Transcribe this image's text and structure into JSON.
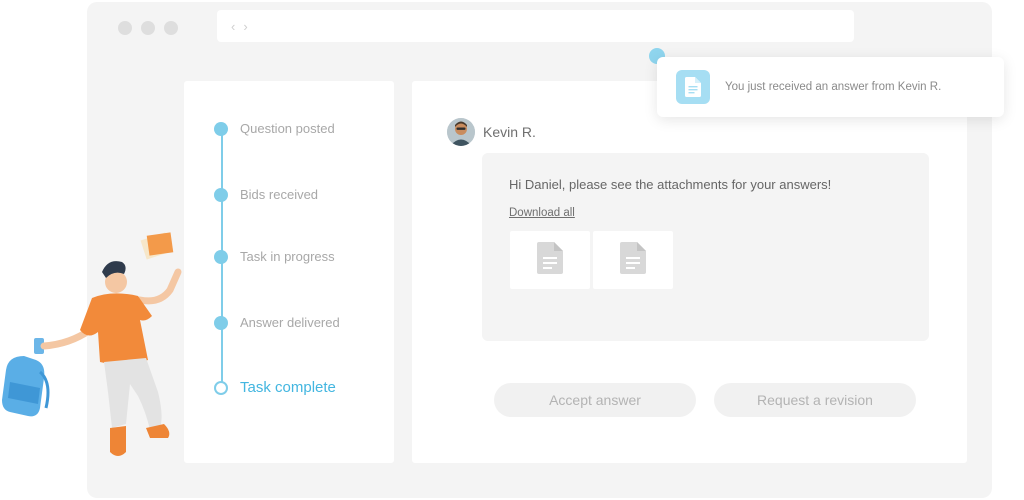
{
  "browser": {
    "nav_back": "‹",
    "nav_forward": "›"
  },
  "timeline": {
    "steps": [
      {
        "label": "Question posted",
        "state": "done"
      },
      {
        "label": "Bids received",
        "state": "done"
      },
      {
        "label": "Task in progress",
        "state": "done"
      },
      {
        "label": "Answer delivered",
        "state": "done"
      },
      {
        "label": "Task complete",
        "state": "current"
      }
    ]
  },
  "message": {
    "sender": "Kevin R.",
    "text": "Hi Daniel, please see the attachments for your answers!",
    "download_label": "Download all",
    "attachments": [
      "document-icon",
      "document-icon"
    ]
  },
  "actions": {
    "accept_label": "Accept answer",
    "revision_label": "Request a revision"
  },
  "notification": {
    "text": "You just received an answer from Kevin R."
  },
  "colors": {
    "accent": "#43b6e0",
    "timeline": "#7fcde9",
    "person_shirt": "#f28a3a"
  }
}
